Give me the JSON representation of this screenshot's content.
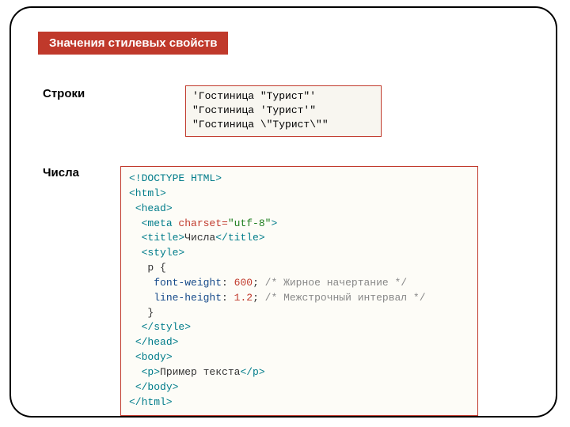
{
  "header": {
    "title": "Значения стилевых свойств"
  },
  "labels": {
    "strings": "Строки",
    "numbers": "Числа"
  },
  "strings_box": {
    "line1": "'Гостиница \"Турист\"'",
    "line2": "\"Гостиница 'Турист'\"",
    "line3": "\"Гостиница \\\"Турист\\\"\""
  },
  "code": {
    "doctype": "<!DOCTYPE HTML>",
    "html_open": "<html>",
    "head_open": "<head>",
    "meta_open": "<meta",
    "meta_attr": " charset=",
    "meta_val": "\"utf-8\"",
    "meta_close": ">",
    "title_open": "<title>",
    "title_text": "Числа",
    "title_close": "</title>",
    "style_open": "<style>",
    "sel": "p {",
    "prop1": "font-weight",
    "colon": ": ",
    "val1": "600",
    "semi": ";",
    "comm1": " /* Жирное начертание */",
    "prop2": "line-height",
    "val2": "1.2",
    "comm2": " /* Межстрочный интервал */",
    "sel_close": "}",
    "style_close": "</style>",
    "head_close": "</head>",
    "body_open": "<body>",
    "p_open": "<p>",
    "p_text": "Пример текста",
    "p_close": "</p>",
    "body_close": "</body>",
    "html_close": "</html>"
  }
}
